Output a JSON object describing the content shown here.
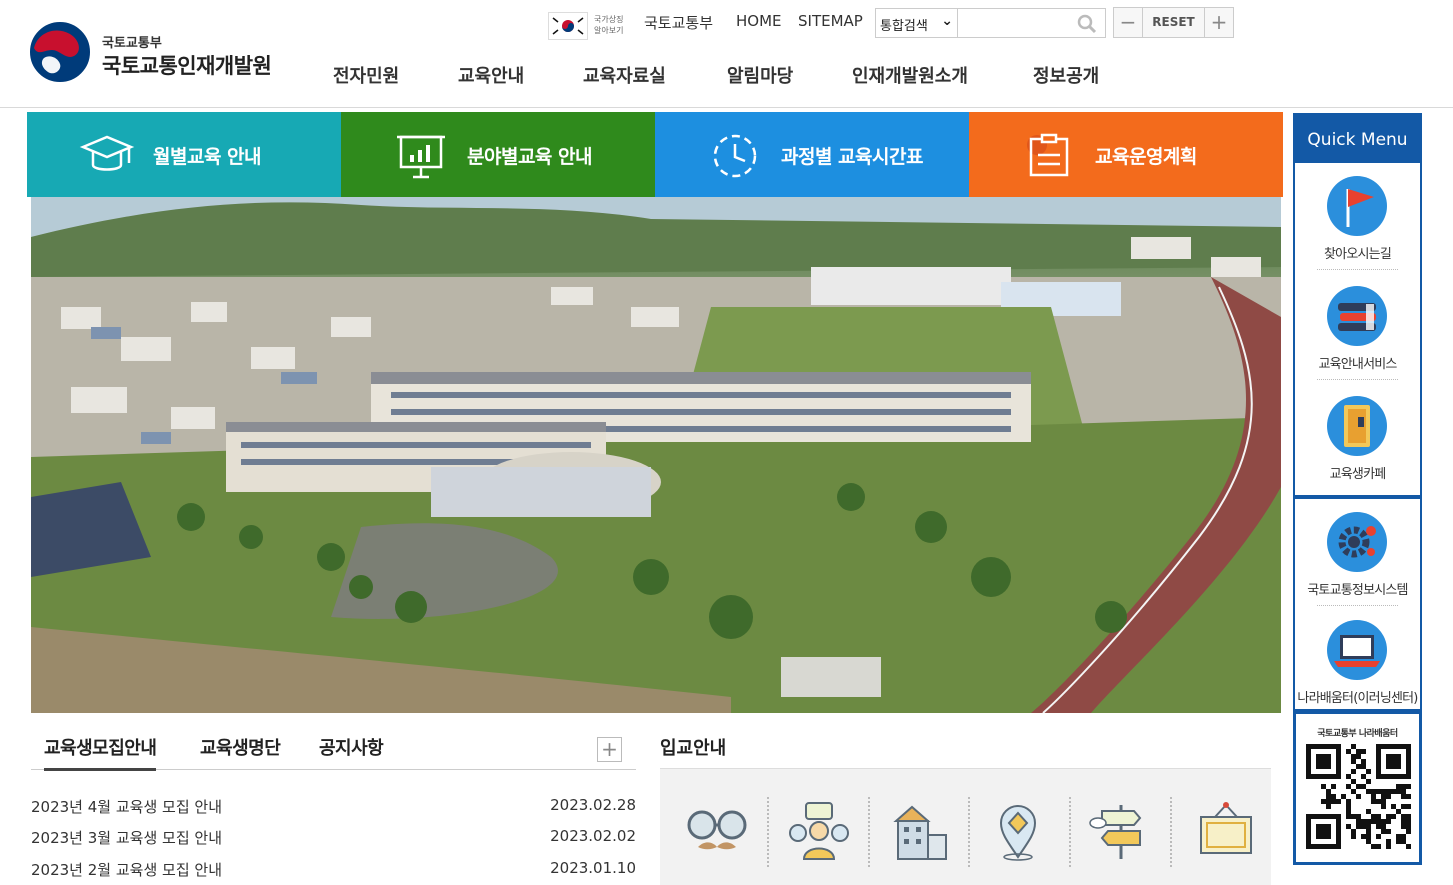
{
  "header": {
    "logo_sub": "국토교통부",
    "logo_main": "국토교통인재개발원",
    "flag_text": "국가상징 알아보기",
    "util_links": [
      "국토교통부",
      "HOME",
      "SITEMAP"
    ],
    "search_select": "통합검색",
    "search_placeholder": "",
    "zoom_reset": "RESET",
    "zoom_minus": "−",
    "zoom_plus": "+",
    "nav": [
      "전자민원",
      "교육안내",
      "교육자료실",
      "알림마당",
      "인재개발원소개",
      "정보공개"
    ]
  },
  "tiles": [
    {
      "label": "월별교육 안내",
      "color": "#17a9b4"
    },
    {
      "label": "분야별교육 안내",
      "color": "#2f8a1c"
    },
    {
      "label": "과정별 교육시간표",
      "color": "#1d8fe0"
    },
    {
      "label": "교육운영계획",
      "color": "#f36b1c"
    }
  ],
  "tabs": {
    "items": [
      "교육생모집안내",
      "교육생명단",
      "공지사항"
    ],
    "more": "+",
    "notices": [
      {
        "title": "2023년 4월 교육생 모집 안내",
        "date": "2023.02.28"
      },
      {
        "title": "2023년 3월 교육생 모집 안내",
        "date": "2023.02.02"
      },
      {
        "title": "2023년 2월 교육생 모집 안내",
        "date": "2023.01.10"
      }
    ]
  },
  "admission": {
    "title": "입교안내",
    "icons": [
      "glasses-mustache-icon",
      "people-chat-icon",
      "building-icon",
      "location-pin-icon",
      "signpost-icon",
      "certificate-icon"
    ]
  },
  "quick_menu": {
    "title": "Quick Menu",
    "items": [
      {
        "label": "찾아오시는길",
        "icon": "flag-icon"
      },
      {
        "label": "교육안내서비스",
        "icon": "books-icon"
      },
      {
        "label": "교육생카페",
        "icon": "cafe-door-icon"
      },
      {
        "label": "국토교통정보시스템",
        "icon": "gear-icon"
      },
      {
        "label": "나라배움터(이러닝센터)",
        "icon": "laptop-icon"
      }
    ],
    "qr_title": "국토교통부 나라배움터"
  },
  "colors": {
    "brand_blue": "#1359a6",
    "logo_red": "#c8102e",
    "logo_blue": "#003b7a"
  }
}
